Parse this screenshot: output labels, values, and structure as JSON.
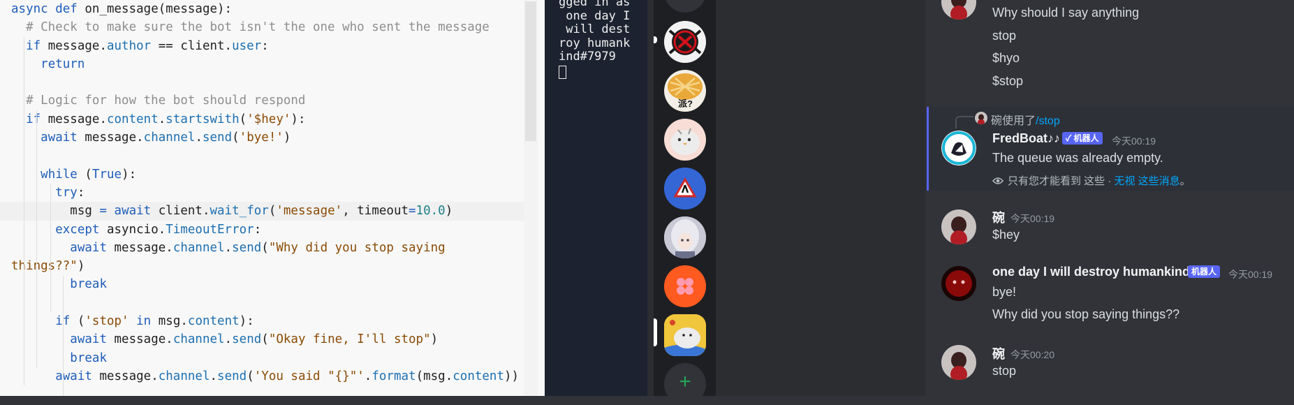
{
  "editor": {
    "lines": [
      [
        [
          "async",
          "k"
        ],
        [
          " ",
          ""
        ],
        [
          "def",
          "k"
        ],
        [
          " on_message(message):",
          ""
        ]
      ],
      [
        [
          "  # Check to make sure the bot isn't the one who sent the message",
          "c"
        ]
      ],
      [
        [
          "  ",
          ""
        ],
        [
          "if",
          "k"
        ],
        [
          " message.",
          ""
        ],
        [
          "author",
          "a"
        ],
        [
          " == client.",
          ""
        ],
        [
          "user",
          "a"
        ],
        [
          ":",
          ""
        ]
      ],
      [
        [
          "    ",
          ""
        ],
        [
          "return",
          "k"
        ]
      ],
      [
        [
          "",
          ""
        ]
      ],
      [
        [
          "  # Logic for how the bot should respond",
          "c"
        ]
      ],
      [
        [
          "  ",
          ""
        ],
        [
          "if",
          "k"
        ],
        [
          " message.",
          ""
        ],
        [
          "content",
          "a"
        ],
        [
          ".",
          ""
        ],
        [
          "startswith",
          "a"
        ],
        [
          "(",
          ""
        ],
        [
          "'$hey'",
          "s"
        ],
        [
          "):",
          ""
        ]
      ],
      [
        [
          "    ",
          ""
        ],
        [
          "await",
          "k"
        ],
        [
          " message.",
          ""
        ],
        [
          "channel",
          "a"
        ],
        [
          ".",
          ""
        ],
        [
          "send",
          "a"
        ],
        [
          "(",
          ""
        ],
        [
          "'bye!'",
          "s"
        ],
        [
          ")",
          ""
        ]
      ],
      [
        [
          "",
          ""
        ]
      ],
      [
        [
          "    ",
          ""
        ],
        [
          "while",
          "k"
        ],
        [
          " (",
          ""
        ],
        [
          "True",
          "k"
        ],
        [
          "):",
          ""
        ]
      ],
      [
        [
          "      ",
          ""
        ],
        [
          "try",
          "k"
        ],
        [
          ":",
          ""
        ]
      ],
      [
        [
          "        msg ",
          ""
        ],
        [
          "=",
          "k"
        ],
        [
          " ",
          ""
        ],
        [
          "await",
          "k"
        ],
        [
          " client.",
          ""
        ],
        [
          "wait_for",
          "a"
        ],
        [
          "(",
          ""
        ],
        [
          "'message'",
          "s"
        ],
        [
          ", timeout",
          ""
        ],
        [
          "=",
          "k"
        ],
        [
          "10.0",
          "n"
        ],
        [
          ")",
          ""
        ]
      ],
      [
        [
          "      ",
          ""
        ],
        [
          "except",
          "k"
        ],
        [
          " asyncio.",
          ""
        ],
        [
          "TimeoutError",
          "a"
        ],
        [
          ":",
          ""
        ]
      ],
      [
        [
          "        ",
          ""
        ],
        [
          "await",
          "k"
        ],
        [
          " message.",
          ""
        ],
        [
          "channel",
          "a"
        ],
        [
          ".",
          ""
        ],
        [
          "send",
          "a"
        ],
        [
          "(",
          ""
        ],
        [
          "\"Why did you stop saying",
          "s"
        ]
      ],
      [
        [
          "things??\"",
          "s"
        ],
        [
          ")",
          ""
        ]
      ],
      [
        [
          "        ",
          ""
        ],
        [
          "break",
          "k"
        ]
      ],
      [
        [
          "",
          ""
        ]
      ],
      [
        [
          "      ",
          ""
        ],
        [
          "if",
          "k"
        ],
        [
          " (",
          ""
        ],
        [
          "'stop'",
          "s"
        ],
        [
          " ",
          ""
        ],
        [
          "in",
          "k"
        ],
        [
          " msg.",
          ""
        ],
        [
          "content",
          "a"
        ],
        [
          "):",
          ""
        ]
      ],
      [
        [
          "        ",
          ""
        ],
        [
          "await",
          "k"
        ],
        [
          " message.",
          ""
        ],
        [
          "channel",
          "a"
        ],
        [
          ".",
          ""
        ],
        [
          "send",
          "a"
        ],
        [
          "(",
          ""
        ],
        [
          "\"Okay fine, I'll stop\"",
          "s"
        ],
        [
          ")",
          ""
        ]
      ],
      [
        [
          "        ",
          ""
        ],
        [
          "break",
          "k"
        ]
      ],
      [
        [
          "      ",
          ""
        ],
        [
          "await",
          "k"
        ],
        [
          " message.",
          ""
        ],
        [
          "channel",
          "a"
        ],
        [
          ".",
          ""
        ],
        [
          "send",
          "a"
        ],
        [
          "(",
          ""
        ],
        [
          "'You said \"{}\"'",
          "s"
        ],
        [
          ".",
          ""
        ],
        [
          "format",
          "a"
        ],
        [
          "(msg.",
          ""
        ],
        [
          "content",
          "a"
        ],
        [
          "))",
          ""
        ]
      ]
    ]
  },
  "terminal": {
    "lines": [
      "gged in as",
      " one day I",
      " will dest",
      "roy humank",
      "ind#7979"
    ]
  },
  "servers": {
    "items": [
      "ff14-server",
      "pie-server",
      "bird-server",
      "warning-server",
      "anime-server",
      "flower-server",
      "seal-server",
      "add-server"
    ],
    "pie_label": "派?",
    "add_label": "+"
  },
  "chat": {
    "m1_lines": [
      "Why should I say anything",
      "stop",
      "$hyo",
      "$stop"
    ],
    "m2": {
      "reply_user": "碗",
      "reply_action": "使用了",
      "reply_command": "/stop",
      "username": "FredBoat♪♪",
      "bot_tag": "✓ 机器人",
      "timestamp": "今天00:19",
      "text": "The queue was already empty.",
      "ephemeral_note": "只有您才能看到 这些 · ",
      "ephemeral_link": "无视 这些消息",
      "ephemeral_end": "。"
    },
    "m3": {
      "username": "碗",
      "timestamp": "今天00:19",
      "text": "$hey"
    },
    "m4": {
      "username": "one day I will destroy humankind",
      "bot_tag": "机器人",
      "timestamp": "今天00:19",
      "lines": [
        "bye!",
        "Why did you stop saying things??"
      ]
    },
    "m5": {
      "username": "碗",
      "timestamp": "今天00:20",
      "text": "stop"
    }
  }
}
